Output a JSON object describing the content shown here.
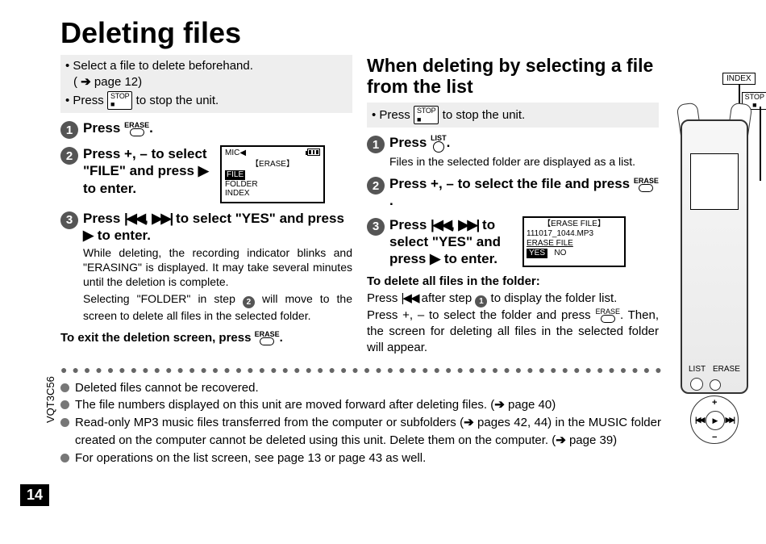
{
  "page": {
    "title": "Deleting files",
    "prep": {
      "line1": "• Select a file to delete beforehand.",
      "line1_ref": "page 12",
      "line2a": "• Press",
      "line2b": "to stop the unit."
    },
    "step1": {
      "lead": "Press",
      "period": "."
    },
    "step2": {
      "line": "Press +, – to select \"FILE\" and press",
      "line_end": " to enter."
    },
    "step3": {
      "line1": "Press ",
      "line2": " to select \"YES\" and press ",
      "line3": " to enter.",
      "sub1": "While deleting, the recording indicator blinks and \"ERASING\" is displayed. It may take several minutes until the deletion is complete.",
      "sub2a": "Selecting \"FOLDER\" in step ",
      "sub2b": " will move to the screen to delete all files in the selected folder."
    },
    "toexit": "To exit the deletion screen, press ",
    "toexit_end": ".",
    "lcd1": {
      "title": "【ERASE】",
      "opt_file": "FILE",
      "opt_folder": "FOLDER",
      "opt_index": "INDEX"
    },
    "right": {
      "heading": "When deleting by selecting a file from the list",
      "prep_a": "• Press",
      "prep_b": "to stop the unit.",
      "s1_lead": "Press",
      "s1_period": ".",
      "s1_sub": "Files in the selected folder are displayed as a list.",
      "s2": "Press +, – to select the file and press ",
      "s2_end": ".",
      "s3a": "Press ",
      "s3b": " to select \"YES\" and press ",
      "s3c": " to enter.",
      "lcd2": {
        "title": "【ERASE FILE】",
        "file": "111017_1044.MP3",
        "erase_file": "ERASE FILE",
        "yes": "YES",
        "no": "NO"
      },
      "folder_del_hdr": "To delete all files in the folder:",
      "folder_del_1a": "Press ",
      "folder_del_1b": " after step ",
      "folder_del_1c": " to display the folder list.",
      "folder_del_2a": "Press +, – to select the folder and press ",
      "folder_del_2b": ". Then, the screen for deleting all files in the selected folder will appear."
    },
    "notes": {
      "n1": "Deleted files cannot be recovered.",
      "n2a": "The file numbers displayed on this unit are moved forward after deleting files. (",
      "n2b": " page 40)",
      "n3a": "Read-only MP3 music files transferred from the computer or subfolders (",
      "n3b": " pages 42, 44) in the MUSIC folder created on the computer cannot be deleted using this unit. Delete them on the computer. (",
      "n3c": " page 39)",
      "n4": "For operations on the list screen, see page 13 or page 43 as well."
    },
    "pagenum": "14",
    "vcode": "VQT3C56",
    "device": {
      "index": "INDEX",
      "stop": "STOP",
      "list": "LIST",
      "erase": "ERASE"
    },
    "btn": {
      "erase_lbl": "ERASE",
      "list_lbl": "LIST",
      "stop_lbl": "STOP"
    }
  }
}
